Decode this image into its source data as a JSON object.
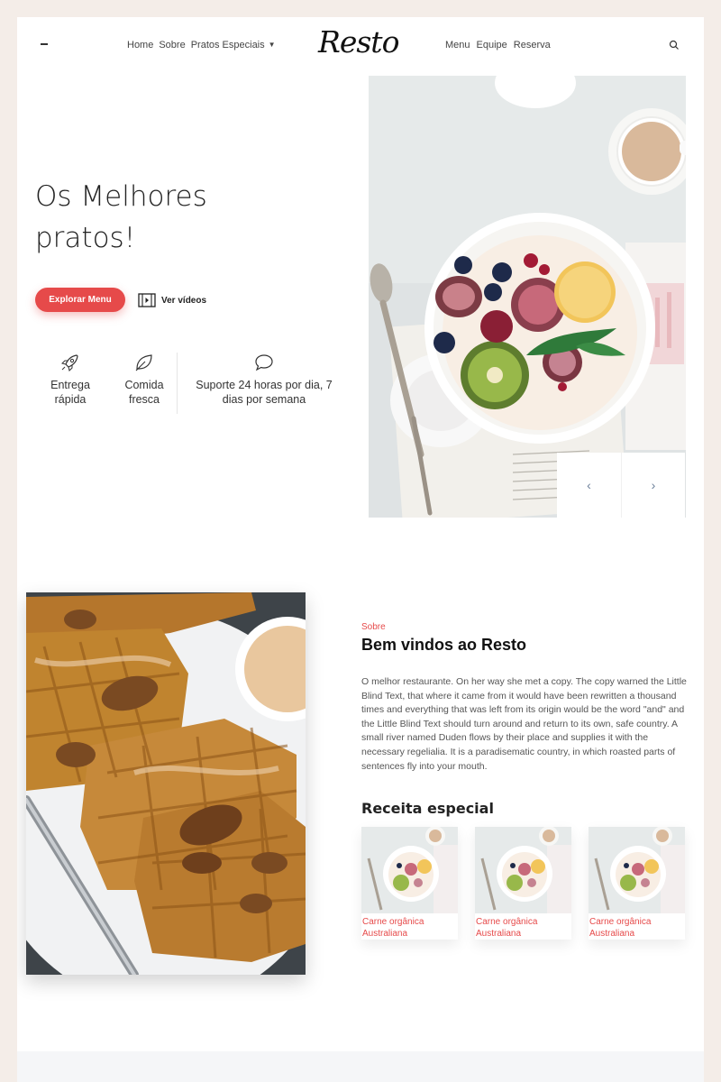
{
  "header": {
    "logo": "Resto",
    "nav_left": [
      "Home",
      "Sobre",
      "Pratos Especiais"
    ],
    "nav_right": [
      "Menu",
      "Equipe",
      "Reserva"
    ],
    "icons": [
      "menu-icon",
      "caret-down-icon",
      "search-icon"
    ]
  },
  "hero": {
    "title_line1": "Os Melhores",
    "title_line2": "pratos!",
    "explore_label": "Explorar Menu",
    "video_label": "Ver vídeos",
    "features": [
      {
        "icon": "rocket-icon",
        "line1": "Entrega",
        "line2": "rápida"
      },
      {
        "icon": "leaf-icon",
        "line1": "Comida",
        "line2": "fresca"
      },
      {
        "icon": "chat-bubble-icon",
        "line1": "Suporte 24 horas por dia, 7",
        "line2": "dias por semana"
      }
    ],
    "slider": {
      "prev": "‹",
      "next": "›"
    }
  },
  "about": {
    "subtitle": "Sobre",
    "title": "Bem vindos ao Resto",
    "text": "O melhor restaurante. On her way she met a copy. The copy warned the Little Blind Text, that where it came from it would have been rewritten a thousand times and everything that was left from its origin would be the word \"and\" and the Little Blind Text should turn around and return to its own, safe country. A small river named Duden flows by their place and supplies it with the necessary regelialia. It is a paradisematic country, in which roasted parts of sentences fly into your mouth.",
    "recipe_heading": "Receita especial",
    "recipes": [
      {
        "line1": "Carne orgânica",
        "line2": "Australiana"
      },
      {
        "line1": "Carne orgânica",
        "line2": "Australiana"
      },
      {
        "line1": "Carne orgânica",
        "line2": "Australiana"
      }
    ]
  },
  "colors": {
    "accent": "#e64a4a",
    "page_bg": "#f4ede8"
  }
}
